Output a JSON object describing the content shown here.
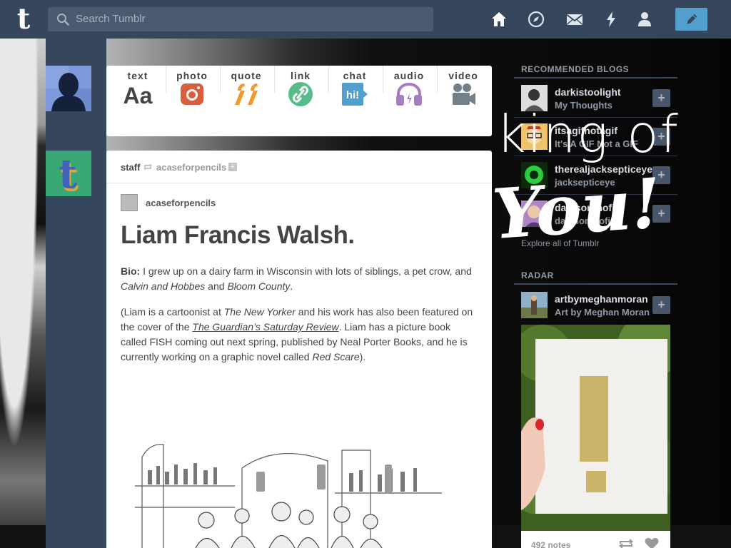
{
  "header": {
    "search_placeholder": "Search Tumblr",
    "nav_icons": [
      "home-icon",
      "compass-icon",
      "mail-icon",
      "lightning-icon",
      "person-icon",
      "pencil-icon"
    ],
    "colors": {
      "bar": "#36465d",
      "compose": "#529ecc"
    }
  },
  "post_types": [
    {
      "label": "text",
      "icon": "text-icon",
      "color": "#444444"
    },
    {
      "label": "photo",
      "icon": "camera-icon",
      "color": "#d95e40"
    },
    {
      "label": "quote",
      "icon": "quote-icon",
      "color": "#f2992e"
    },
    {
      "label": "link",
      "icon": "link-icon",
      "color": "#56bc8a"
    },
    {
      "label": "chat",
      "icon": "chat-icon",
      "color": "#529ecc"
    },
    {
      "label": "audio",
      "icon": "headphones-icon",
      "color": "#a77dc2"
    },
    {
      "label": "video",
      "icon": "video-camera-icon",
      "color": "#748089"
    }
  ],
  "post": {
    "reblogged_by": "staff",
    "reblogged_from": "acaseforpencils",
    "source_blog": "acaseforpencils",
    "title": "Liam Francis Walsh.",
    "bio_label": "Bio:",
    "bio_text_1": " I grew up on a dairy farm in Wisconsin with lots of siblings, a pet crow, and ",
    "bio_em_1": "Calvin and Hobbes",
    "bio_text_2": " and ",
    "bio_em_2": "Bloom County",
    "bio_text_3": ".",
    "p2_text_1": "(Liam is a cartoonist at ",
    "p2_em_1": "The New Yorker",
    "p2_text_2": " and his work has also been featured on the cover of the ",
    "p2_link": "The Guardian’s Saturday Review",
    "p2_text_3": ". Liam has a picture book called FISH coming out next spring, published by Neal Porter Books, and he is currently working on a graphic novel called ",
    "p2_em_2": "Red Scare",
    "p2_text_4": ")."
  },
  "sidebar": {
    "recommended_heading": "RECOMMENDED BLOGS",
    "recommended": [
      {
        "name": "darkistoolight",
        "desc": "My Thoughts"
      },
      {
        "name": "itsagifnotagif",
        "desc": "It's A GIF Not a GIF"
      },
      {
        "name": "therealjacksepticeye",
        "desc": "jacksepticeye"
      },
      {
        "name": "danisontnofire",
        "desc": "danisontnofire"
      }
    ],
    "explore_text": "Explore all of Tumblr",
    "radar_heading": "RADAR",
    "radar": {
      "name": "artbymeghanmoran",
      "desc": "Art by Meghan Moran",
      "notes": "492 notes"
    }
  },
  "overlay": {
    "line1": "king of",
    "line2": "You!"
  }
}
